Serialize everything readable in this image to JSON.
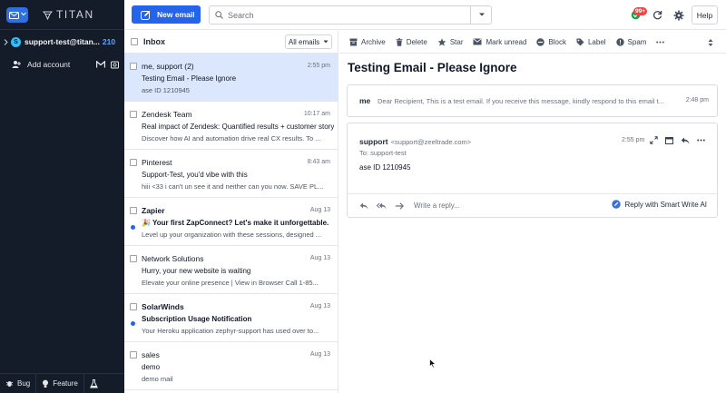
{
  "brand": {
    "name": "TITAN"
  },
  "account": {
    "initial": "S",
    "name": "support-test@titan...",
    "count": "210"
  },
  "add_account": {
    "label": "Add account"
  },
  "footer": {
    "bug": "Bug",
    "feature": "Feature"
  },
  "topbar": {
    "new_email": "New email",
    "search_placeholder": "Search",
    "badge": "99+",
    "help": "Help"
  },
  "list": {
    "title": "Inbox",
    "filter": "All emails",
    "mails": [
      {
        "from": "me, support (2)",
        "date": "2:55 pm",
        "subject": "Testing Email - Please Ignore",
        "snippet": "ase ID 1210945",
        "selected": true,
        "unread": false
      },
      {
        "from": "Zendesk Team",
        "date": "10:17 am",
        "subject": "Real impact of Zendesk: Quantified results + customer story",
        "snippet": "Discover how AI and automation drive real CX results. To ...",
        "selected": false,
        "unread": false
      },
      {
        "from": "Pinterest",
        "date": "8:43 am",
        "subject": "Support-Test, you'd vibe with this",
        "snippet": "hiii <33 i can't un see it and neither can you now. SAVE PL...",
        "selected": false,
        "unread": false
      },
      {
        "from": "Zapier",
        "date": "Aug 13",
        "subject": "🎉 Your first ZapConnect? Let's make it unforgettable.",
        "snippet": "Level up your organization with these sessions, designed ...",
        "selected": false,
        "unread": true
      },
      {
        "from": "Network Solutions",
        "date": "Aug 13",
        "subject": "Hurry, your new website is waiting",
        "snippet": "Elevate your online presence  |  View in Browser Call 1-85...",
        "selected": false,
        "unread": false
      },
      {
        "from": "SolarWinds",
        "date": "Aug 13",
        "subject": "Subscription Usage Notification",
        "snippet": "Your Heroku application zephyr-support has used over to...",
        "selected": false,
        "unread": true
      },
      {
        "from": "sales",
        "date": "Aug 13",
        "subject": "demo",
        "snippet": "demo mail",
        "selected": false,
        "unread": false
      }
    ]
  },
  "toolbar": {
    "archive": "Archive",
    "delete": "Delete",
    "star": "Star",
    "mark_unread": "Mark unread",
    "block": "Block",
    "label": "Label",
    "spam": "Spam"
  },
  "reader": {
    "subject": "Testing Email - Please Ignore",
    "collapsed": {
      "from": "me",
      "preview": "Dear Recipient, This is a test email. If you receive this message, kindly respond to this email t...",
      "time": "2:48 pm"
    },
    "expanded": {
      "from": "support",
      "address": "<support@zeeltrade.com>",
      "to": "To: support-test",
      "time": "2:55 pm",
      "body": "ase ID 1210945"
    },
    "reply_placeholder": "Write a reply...",
    "smart_write": "Reply with Smart Write AI"
  },
  "colors": {
    "accent": "#2563eb",
    "sidebar": "#141b29",
    "selected_row": "#dbe7fd",
    "badge": "#ef4444"
  }
}
